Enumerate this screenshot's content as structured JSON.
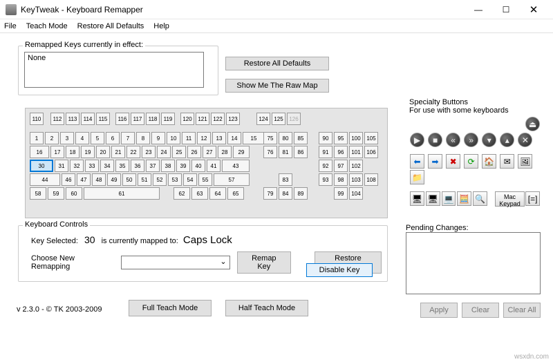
{
  "window": {
    "title": "KeyTweak -  Keyboard Remapper",
    "min": "—",
    "max": "☐",
    "close": "✕"
  },
  "menu": {
    "file": "File",
    "teach": "Teach Mode",
    "restore": "Restore All Defaults",
    "help": "Help"
  },
  "remapped": {
    "legend": "Remapped Keys currently in effect:",
    "none": "None"
  },
  "buttons": {
    "restoreAll": "Restore All Defaults",
    "showRaw": "Show Me The Raw Map",
    "remap": "Remap Key",
    "restoreDef": "Restore Default",
    "disable": "Disable Key",
    "fullTeach": "Full Teach Mode",
    "halfTeach": "Half Teach Mode",
    "apply": "Apply",
    "clear": "Clear",
    "clearAll": "Clear All",
    "macKeypad": "Mac Keypad"
  },
  "kbcontrols": {
    "legend": "Keyboard Controls",
    "selLabel": "Key Selected:",
    "selKey": "30",
    "mappedLabel": "is currently mapped to:",
    "mappedVal": "Caps Lock",
    "chooseLabel": "Choose New Remapping"
  },
  "specialty": {
    "title": "Specialty Buttons",
    "sub": "For use with some keyboards",
    "eq": "[=]"
  },
  "pending": {
    "title": "Pending Changes:"
  },
  "version": "v 2.3.0 - © TK 2003-2009",
  "watermark": "wsxdn.com",
  "keyboard": {
    "row0": [
      "110",
      "112",
      "113",
      "114",
      "115",
      "116",
      "117",
      "118",
      "119",
      "120",
      "121",
      "122",
      "123",
      "124",
      "125",
      "126"
    ],
    "row1": [
      "1",
      "2",
      "3",
      "4",
      "5",
      "6",
      "7",
      "8",
      "9",
      "10",
      "11",
      "12",
      "13",
      "14",
      "15"
    ],
    "row2": [
      "16",
      "17",
      "18",
      "19",
      "20",
      "21",
      "22",
      "23",
      "24",
      "25",
      "26",
      "27",
      "28",
      "29"
    ],
    "row3": [
      "30",
      "31",
      "32",
      "33",
      "34",
      "35",
      "36",
      "37",
      "38",
      "39",
      "40",
      "41",
      "43"
    ],
    "row4": [
      "44",
      "46",
      "47",
      "48",
      "49",
      "50",
      "51",
      "52",
      "53",
      "54",
      "55",
      "57"
    ],
    "row5": [
      "58",
      "59",
      "60",
      "61",
      "62",
      "63",
      "64",
      "65"
    ],
    "nav1": [
      "75",
      "80",
      "85"
    ],
    "nav2": [
      "76",
      "81",
      "86"
    ],
    "nav3": [
      "83"
    ],
    "nav4": [
      "79",
      "84",
      "89"
    ],
    "np0": [
      "90",
      "95",
      "100",
      "105"
    ],
    "np1": [
      "91",
      "96",
      "101",
      "106"
    ],
    "np2": [
      "92",
      "97",
      "102"
    ],
    "np3": [
      "93",
      "98",
      "103"
    ],
    "np4": [
      "99",
      "104"
    ],
    "np5": [
      "108"
    ]
  }
}
